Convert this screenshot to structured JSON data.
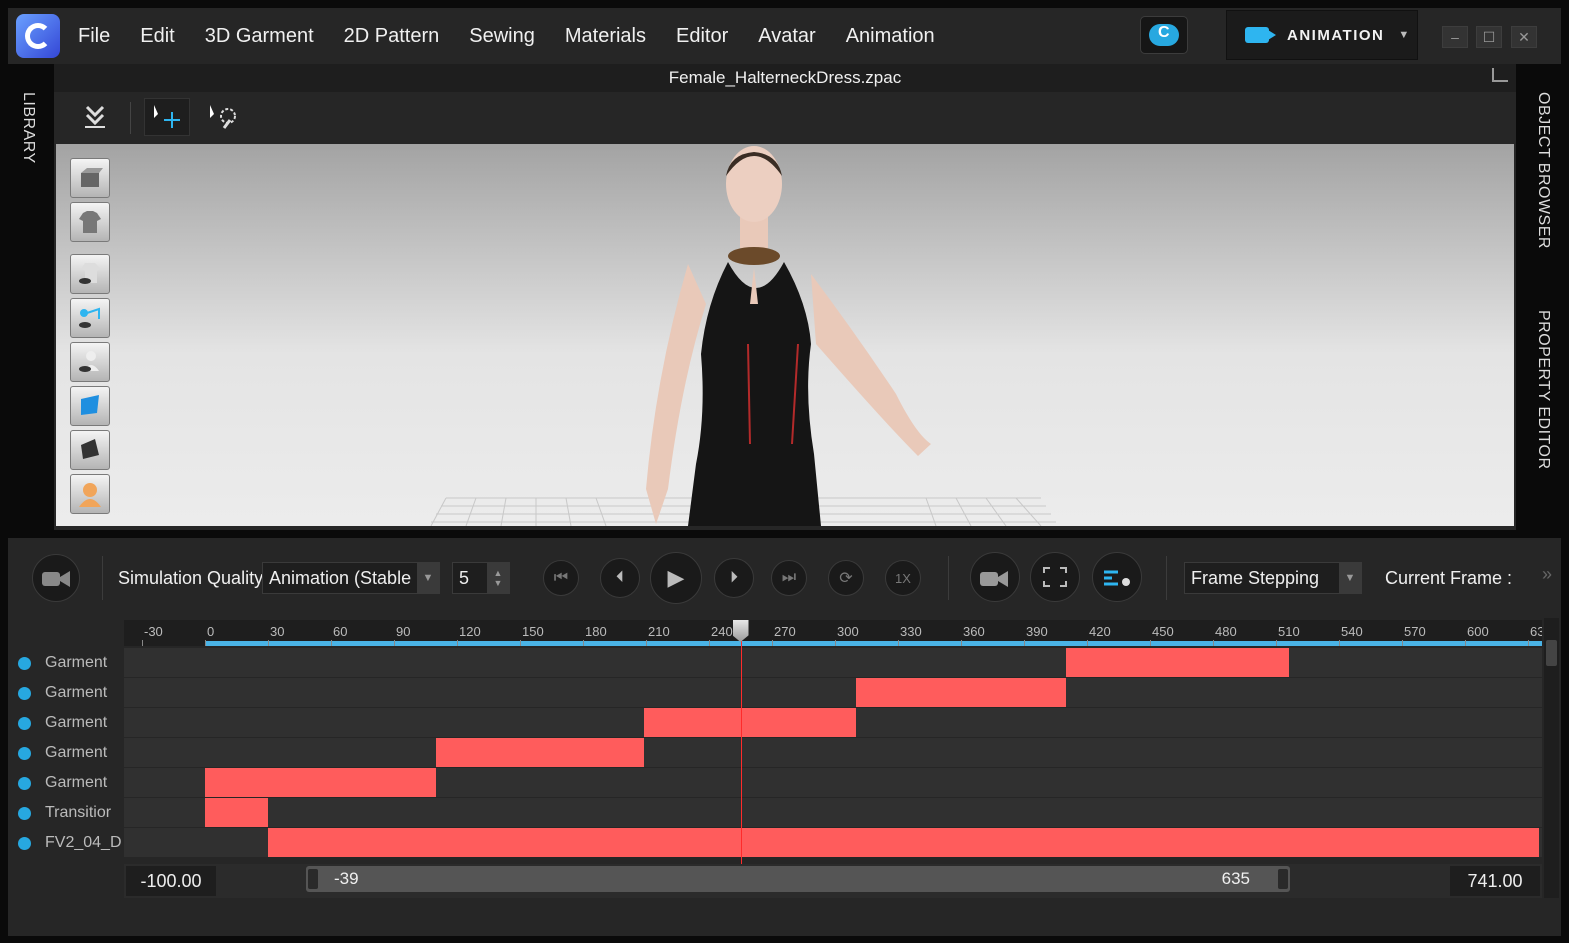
{
  "menu": {
    "items": [
      "File",
      "Edit",
      "3D Garment",
      "2D Pattern",
      "Sewing",
      "Materials",
      "Editor",
      "Avatar",
      "Animation"
    ]
  },
  "mode_switch": {
    "label": "ANIMATION"
  },
  "window_controls": {
    "minimize": "–",
    "maximize": "☐",
    "close": "✕"
  },
  "side_tabs": {
    "library": "LIBRARY",
    "object_browser": "OBJECT BROWSER",
    "property_editor": "PROPERTY EDITOR"
  },
  "viewport": {
    "file_title": "Female_HalterneckDress.zpac"
  },
  "transport": {
    "sim_quality_label": "Simulation Quality",
    "sim_quality_value": "Animation (Stable",
    "step_value": "5",
    "speed_label": "1X",
    "frame_mode_value": "Frame Stepping",
    "current_frame_label": "Current Frame :",
    "expand_icon": "»"
  },
  "timeline": {
    "ruler_ticks": [
      "-30",
      "0",
      "30",
      "60",
      "90",
      "120",
      "150",
      "180",
      "210",
      "240",
      "270",
      "300",
      "330",
      "360",
      "390",
      "420",
      "450",
      "480",
      "510",
      "540",
      "570",
      "600",
      "63"
    ],
    "tracks": [
      {
        "label": "Garment",
        "clip_start_frame": 410,
        "clip_end_frame": 516
      },
      {
        "label": "Garment",
        "clip_start_frame": 310,
        "clip_end_frame": 410
      },
      {
        "label": "Garment",
        "clip_start_frame": 209,
        "clip_end_frame": 310
      },
      {
        "label": "Garment",
        "clip_start_frame": 110,
        "clip_end_frame": 209
      },
      {
        "label": "Garment",
        "clip_start_frame": 0,
        "clip_end_frame": 110
      },
      {
        "label": "Transitior",
        "clip_start_frame": 0,
        "clip_end_frame": 30
      },
      {
        "label": "FV2_04_D",
        "clip_start_frame": 30,
        "clip_end_frame": 635
      }
    ],
    "playhead_frame": 255,
    "range_min": "-100.00",
    "range_max": "741.00",
    "view_start": "-39",
    "view_end": "635"
  }
}
